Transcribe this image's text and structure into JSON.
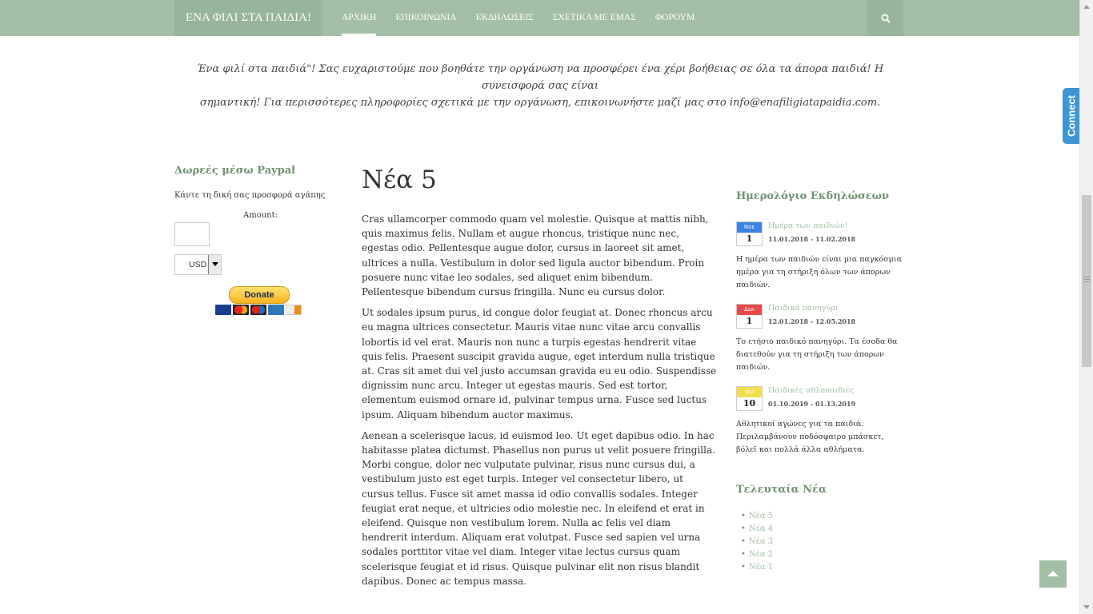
{
  "header": {
    "brand": "ΕΝΑ ΦΙΛΙ ΣΤΑ ΠΑΙΔΙΑ!",
    "nav": [
      "ΑΡΧΙΚΗ",
      "ΕΠΙΚΟΙΝΩΝΙΑ",
      "ΕΚΔΗΛΩΣΕΙΣ",
      "ΣΧΕΤΙΚΑ ΜΕ ΕΜΑΣ",
      "ΦΟΡΟΥΜ"
    ],
    "active_nav": "ΑΡΧΙΚΗ",
    "search_icon": "search-icon"
  },
  "connect_tab": "Connect",
  "intro": {
    "line1": "Ένα φιλί στα παιδιά\"! Σας ευχαριστούμε που βοηθάτε την οργάνωση να προσφέρει ένα χέρι βοήθειας σε όλα τα άπορα παιδιά! Η συνεισφορά σας είναι",
    "line2": "σημαντική! Για περισσότερες πληροφορίες σχετικά με την οργάνωση, επικοινωνήστε μαζί μας στο info@enafiligiatapaidia.com."
  },
  "donation": {
    "title": "Δωρεές μέσω Paypal",
    "description": "Κάντε τη δική σας προσφορά αγάπης",
    "amount_label": "Amount:",
    "amount_value": "",
    "currency": "USD",
    "donate_label": "Donate",
    "cards": [
      "VISA",
      "Mastercard",
      "Maestro",
      "American Express",
      "Discover"
    ]
  },
  "article": {
    "title": "Νέα 5",
    "paragraphs": [
      "Cras ullamcorper commodo quam vel molestie. Quisque at mattis nibh, quis maximus felis. Nullam et augue rhoncus, tristique nunc nec, egestas odio. Pellentesque augue dolor, cursus in laoreet sit amet, ultrices a nulla. Vestibulum in dolor sed ligula auctor bibendum. Proin posuere nunc vitae leo sodales, sed aliquet enim bibendum. Pellentesque bibendum cursus fringilla. Nunc eu cursus dolor.",
      "Ut sodales ipsum purus, id congue dolor feugiat at. Donec rhoncus arcu eu magna ultrices consectetur. Mauris vitae nunc vitae arcu convallis lobortis id vel erat. Mauris non nunc a turpis egestas hendrerit vitae quis felis. Praesent suscipit gravida augue, eget interdum nulla tristique at. Cras sit amet dui vel justo accumsan gravida eu eu odio. Suspendisse dignissim nunc arcu. Integer ut egestas mauris. Sed est tortor, elementum euismod ornare id, pulvinar tempus urna. Fusce sed luctus ipsum. Aliquam bibendum auctor maximus.",
      "Aenean a scelerisque lacus, id euismod leo. Ut eget dapibus odio. In hac habitasse platea dictumst. Phasellus non purus ut velit posuere fringilla. Morbi congue, dolor nec vulputate pulvinar, risus nunc cursus dui, a vestibulum justo est eget turpis. Integer vel consectetur libero, ut cursus tellus. Fusce sit amet massa id odio convallis sodales. Integer feugiat erat neque, et ultricies odio molestie nec. In eleifend et erat in eleifend. Quisque non vestibulum lorem. Nulla ac felis vel diam hendrerit interdum. Aliquam erat volutpat. Fusce sed sapien vel urna sodales porttitor vitae vel diam. Integer vitae lectus cursus quam scelerisque feugiat et id risus. Quisque pulvinar elit non risus blandit dapibus. Donec ac tempus massa."
    ]
  },
  "events": {
    "title": "Ημερολόγιο Εκδηλώσεων",
    "items": [
      {
        "month": "Νοε",
        "day": "1",
        "color": "#3b82e6",
        "title": "Ημέρα των παιδιών!",
        "range": "11.01.2018 - 11.02.2018",
        "desc": "Η ημέρα των παιδιών είναι μια παγκόσμια ημέρα για τη στήριξη όλων των άπορων παιδιών."
      },
      {
        "month": "Δεκ",
        "day": "1",
        "color": "#e84a4a",
        "title": "Παιδικό πανηγύρι",
        "range": "12.01.2018 - 12.05.2018",
        "desc": "Το ετήσιο παιδικό πανηγύρι. Τα έσοδα θα διατεθούν για τη στήριξη των άπορων παιδιών."
      },
      {
        "month": "Ιαν",
        "day": "10",
        "color": "#f0de4a",
        "title": "Παιδικές αθλοπαιδιές",
        "range": "01.10.2019 - 01.13.2019",
        "desc": "Αθλητικοί αγώνες για τα παιδιά. Περιλαμβάνουν ποδόσφαιρο μπάσκετ, βόλεϊ και πολλά άλλα αθλήματα."
      }
    ]
  },
  "latest_news": {
    "title": "Τελευταία Νέα",
    "items": [
      "Νέα 5",
      "Νέα 4",
      "Νέα 3",
      "Νέα 2",
      "Νέα 1"
    ]
  },
  "back_to_top_icon": "arrow-up-icon"
}
